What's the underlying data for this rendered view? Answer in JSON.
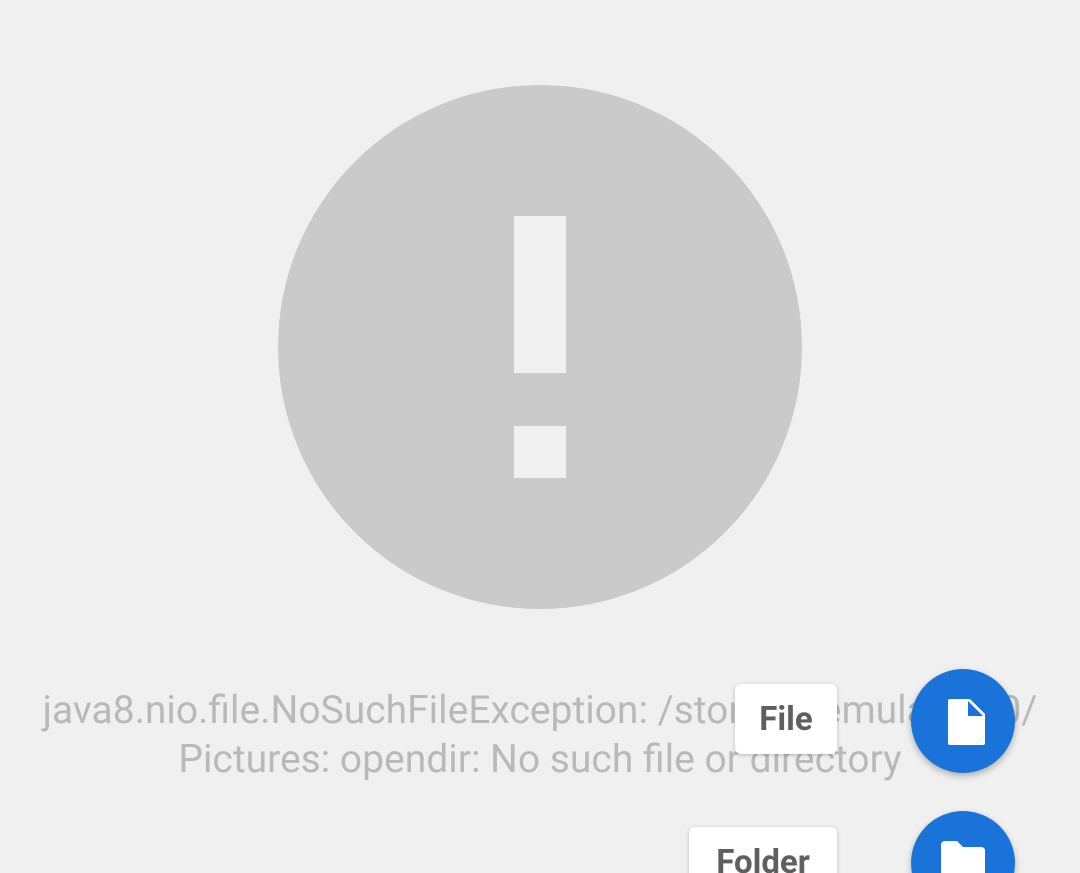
{
  "error": {
    "icon": "alert-circle-icon",
    "message_line1": "java8.nio.file.NoSuchFileException: /storage/emulated/0/",
    "message_line2": "Pictures: opendir: No such file or directory"
  },
  "fab_menu": {
    "file_label": "File",
    "file_icon": "file-icon",
    "folder_label": "Folder",
    "folder_icon": "folder-icon"
  },
  "colors": {
    "background": "#f0f0f0",
    "icon_gray": "#cacaca",
    "text_gray": "#b9b9b9",
    "fab_blue": "#1a73d9"
  }
}
